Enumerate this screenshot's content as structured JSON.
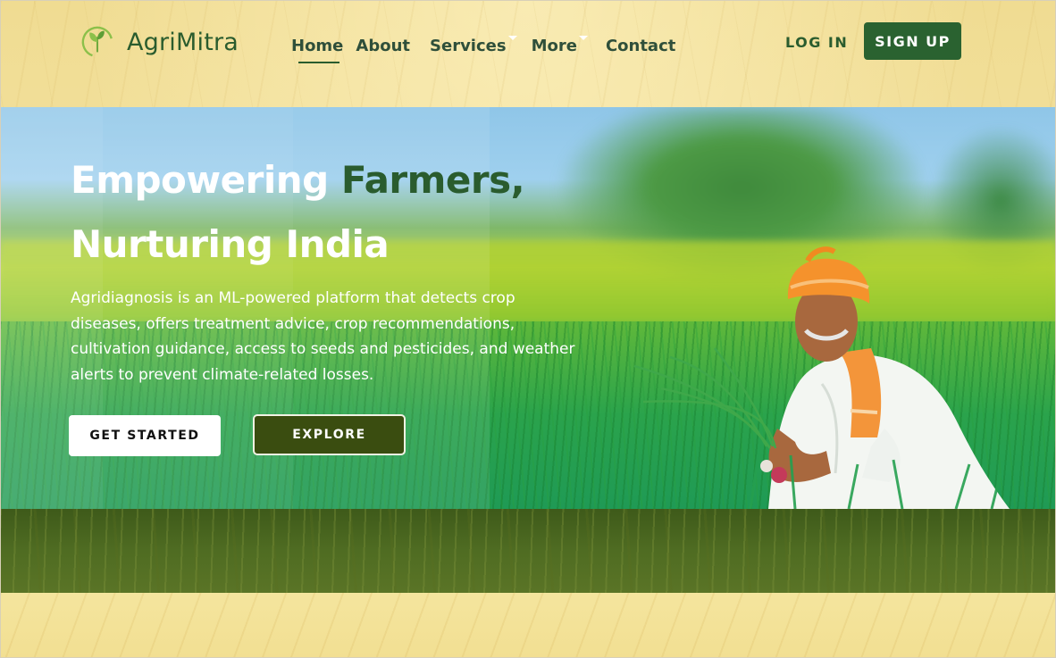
{
  "brand": {
    "name": "AgriMitra",
    "logo_icon": "leaf-sprout-icon"
  },
  "nav": {
    "links": [
      {
        "label": "Home",
        "active": true
      },
      {
        "label": "About"
      },
      {
        "label": "Services",
        "dropdown": true
      },
      {
        "label": "More",
        "dropdown": true
      },
      {
        "label": "Contact"
      }
    ],
    "login_label": "LOG IN",
    "signup_label": "SIGN UP"
  },
  "hero": {
    "title_part1": "Empowering ",
    "title_accent": "Farmers,",
    "title_line2": "Nurturing India",
    "description": "Agridiagnosis is an ML-powered platform that detects crop diseases, offers treatment advice, crop recommendations, cultivation guidance, access to seeds and pesticides, and weather alerts to prevent climate-related losses.",
    "primary_cta": "GET STARTED",
    "secondary_cta": "EXPLORE"
  },
  "colors": {
    "brand_green": "#2a5c2e",
    "signup_bg": "#2a6230",
    "explore_bg": "#3a4d10",
    "page_bg": "#f3e2a0"
  }
}
